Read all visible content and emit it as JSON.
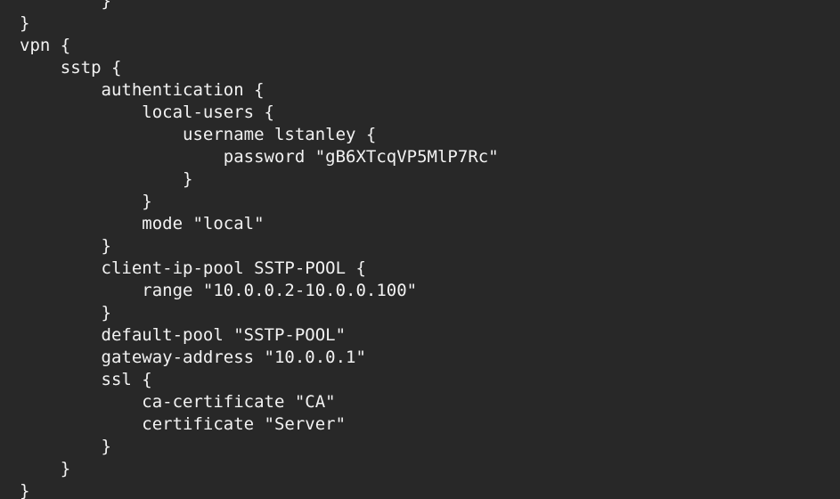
{
  "terminal": {
    "background_color": "#282828",
    "text_color": "#f2f2f2",
    "font_size_px": 19,
    "line_height_px": 25,
    "indent_unit_spaces": 4
  },
  "config": {
    "section": "vpn",
    "subsection": "sstp",
    "username": "lstanley",
    "password": "gB6XTcqVP5MlP7Rc",
    "auth_mode": "local",
    "pool_name": "SSTP-POOL",
    "pool_range": "10.0.0.2-10.0.0.100",
    "default_pool": "SSTP-POOL",
    "gateway_address": "10.0.0.1",
    "ca_certificate": "CA",
    "certificate": "Server"
  },
  "lines": [
    "        }",
    "}",
    "vpn {",
    "    sstp {",
    "        authentication {",
    "            local-users {",
    "                username lstanley {",
    "                    password \"gB6XTcqVP5MlP7Rc\"",
    "                }",
    "            }",
    "            mode \"local\"",
    "        }",
    "        client-ip-pool SSTP-POOL {",
    "            range \"10.0.0.2-10.0.0.100\"",
    "        }",
    "        default-pool \"SSTP-POOL\"",
    "        gateway-address \"10.0.0.1\"",
    "        ssl {",
    "            ca-certificate \"CA\"",
    "            certificate \"Server\"",
    "        }",
    "    }",
    "}"
  ]
}
